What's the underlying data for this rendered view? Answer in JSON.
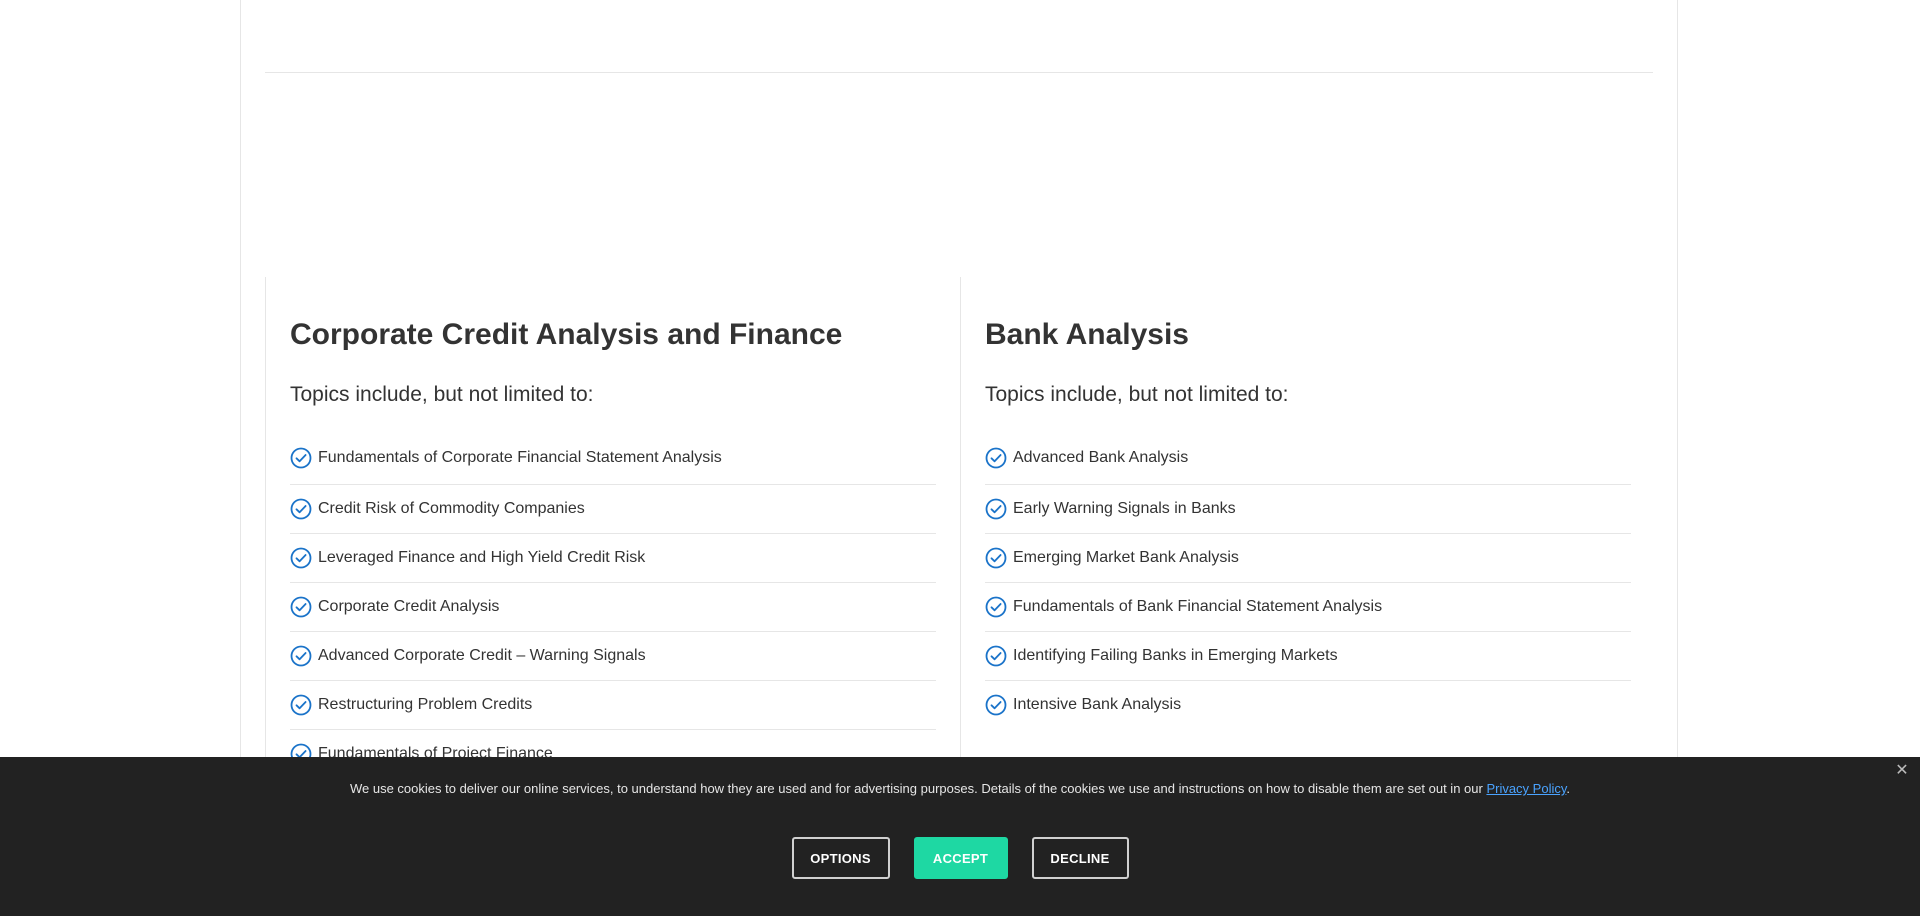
{
  "columns": [
    {
      "title": "Corporate Credit Analysis and Finance",
      "subtitle": "Topics include, but not limited to:",
      "topics": [
        "Fundamentals of Corporate Financial Statement Analysis",
        "Credit Risk of Commodity Companies",
        "Leveraged Finance and High Yield Credit Risk",
        "Corporate Credit Analysis",
        "Advanced Corporate Credit – Warning Signals",
        "Restructuring Problem Credits",
        "Fundamentals of Project Finance"
      ]
    },
    {
      "title": "Bank Analysis",
      "subtitle": "Topics include, but not limited to:",
      "topics": [
        "Advanced Bank Analysis",
        "Early Warning Signals in Banks",
        "Emerging Market Bank Analysis",
        "Fundamentals of Bank Financial Statement Analysis",
        "Identifying Failing Banks in Emerging Markets",
        "Intensive Bank Analysis"
      ]
    }
  ],
  "cookie": {
    "text": "We use cookies to deliver our online services, to understand how they are used and for advertising purposes. Details of the cookies we use and instructions on how to disable them are set out in our ",
    "link_label": "Privacy Policy",
    "text_end": ".",
    "close_icon": "close-icon",
    "buttons": {
      "options": "OPTIONS",
      "accept": "ACCEPT",
      "decline": "DECLINE"
    }
  },
  "colors": {
    "check_icon": "#1a73c9",
    "accept_button": "#1ed8a3",
    "banner_bg": "#222222",
    "link": "#4aa3ff"
  },
  "icons": {
    "topic_bullet": "check-circle-icon"
  }
}
